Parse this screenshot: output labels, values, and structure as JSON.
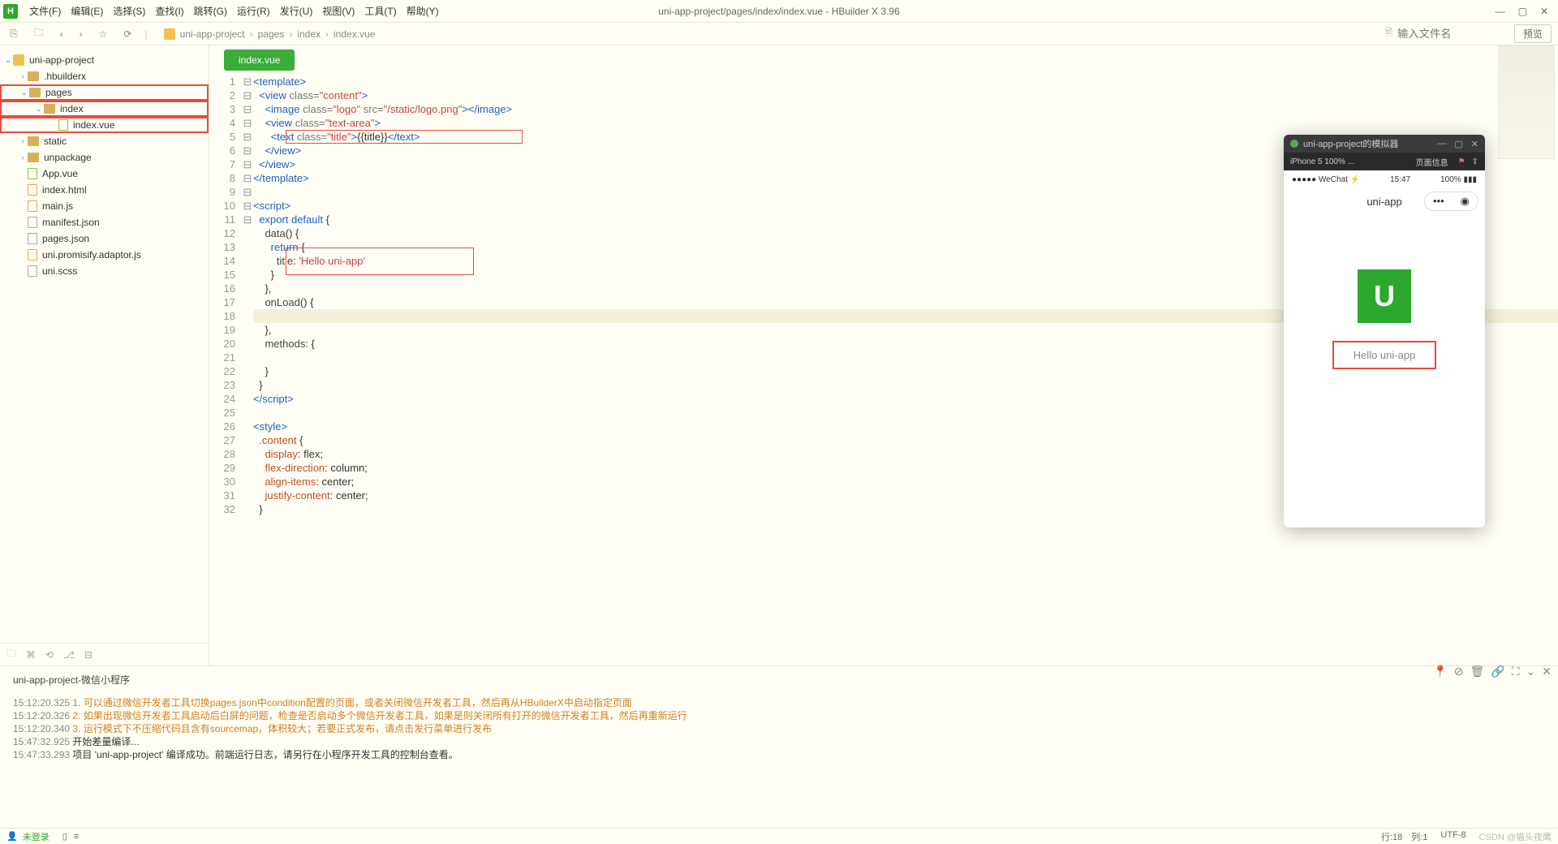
{
  "window_title": "uni-app-project/pages/index/index.vue - HBuilder X 3.96",
  "menus": [
    "文件(F)",
    "编辑(E)",
    "选择(S)",
    "查找(I)",
    "跳转(G)",
    "运行(R)",
    "发行(U)",
    "视图(V)",
    "工具(T)",
    "帮助(Y)"
  ],
  "search_placeholder": "输入文件名",
  "preview_btn": "预览",
  "breadcrumb": [
    "uni-app-project",
    "pages",
    "index",
    "index.vue"
  ],
  "tree": {
    "root": "uni-app-project",
    "items": [
      {
        "label": ".hbuilderx",
        "indent": 1,
        "type": "folder",
        "chev": "›"
      },
      {
        "label": "pages",
        "indent": 1,
        "type": "folder",
        "chev": "⌄",
        "red": true
      },
      {
        "label": "index",
        "indent": 2,
        "type": "folder",
        "chev": "⌄",
        "red": true
      },
      {
        "label": "index.vue",
        "indent": 3,
        "type": "file-green",
        "red": true
      },
      {
        "label": "static",
        "indent": 1,
        "type": "folder",
        "chev": "›"
      },
      {
        "label": "unpackage",
        "indent": 1,
        "type": "folder",
        "chev": "›"
      },
      {
        "label": "App.vue",
        "indent": 1,
        "type": "file-green"
      },
      {
        "label": "index.html",
        "indent": 1,
        "type": "file-orange"
      },
      {
        "label": "main.js",
        "indent": 1,
        "type": "file-orange"
      },
      {
        "label": "manifest.json",
        "indent": 1,
        "type": "file-gray"
      },
      {
        "label": "pages.json",
        "indent": 1,
        "type": "file-gray"
      },
      {
        "label": "uni.promisify.adaptor.js",
        "indent": 1,
        "type": "file-orange"
      },
      {
        "label": "uni.scss",
        "indent": 1,
        "type": "file-gray"
      }
    ]
  },
  "tab_name": "index.vue",
  "code": [
    {
      "n": 1,
      "f": "⊟",
      "h": "<span class='tag'>&lt;template&gt;</span>"
    },
    {
      "n": 2,
      "f": "⊟",
      "h": "  <span class='tag'>&lt;view</span> <span class='attr'>class=</span><span class='str'>\"content\"</span><span class='tag'>&gt;</span>"
    },
    {
      "n": 3,
      "f": "",
      "h": "    <span class='tag'>&lt;image</span> <span class='attr'>class=</span><span class='str'>\"logo\"</span> <span class='attr'>src=</span><span class='str'>\"/static/logo.png\"</span><span class='tag'>&gt;&lt;/image&gt;</span>"
    },
    {
      "n": 4,
      "f": "⊟",
      "h": "    <span class='tag'>&lt;view</span> <span class='attr'>class=</span><span class='str'>\"text-area\"</span><span class='tag'>&gt;</span>"
    },
    {
      "n": 5,
      "f": "",
      "h": "      <span class='tag'>&lt;text</span> <span class='attr'>class=</span><span class='str'>\"title\"</span><span class='tag'>&gt;</span>{{title}}<span class='tag'>&lt;/text&gt;</span>",
      "red": true
    },
    {
      "n": 6,
      "f": "",
      "h": "    <span class='tag'>&lt;/view&gt;</span>"
    },
    {
      "n": 7,
      "f": "",
      "h": "  <span class='tag'>&lt;/view&gt;</span>"
    },
    {
      "n": 8,
      "f": "",
      "h": "<span class='tag'>&lt;/template&gt;</span>"
    },
    {
      "n": 9,
      "f": "",
      "h": ""
    },
    {
      "n": 10,
      "f": "⊟",
      "h": "<span class='tag'>&lt;script&gt;</span>"
    },
    {
      "n": 11,
      "f": "⊟",
      "h": "  <span class='kw'>export default</span> {"
    },
    {
      "n": 12,
      "f": "⊟",
      "h": "    <span class='prop'>data</span>() {"
    },
    {
      "n": 13,
      "f": "⊟",
      "h": "      <span class='kw'>return</span> {"
    },
    {
      "n": 14,
      "f": "",
      "h": "        <span class='prop'>title:</span> <span class='str'>'Hello uni-app'</span>",
      "red2": true
    },
    {
      "n": 15,
      "f": "",
      "h": "      }"
    },
    {
      "n": 16,
      "f": "",
      "h": "    },"
    },
    {
      "n": 17,
      "f": "⊟",
      "h": "    <span class='prop'>onLoad</span>() {"
    },
    {
      "n": 18,
      "f": "",
      "h": "",
      "cur": true
    },
    {
      "n": 19,
      "f": "",
      "h": "    },"
    },
    {
      "n": 20,
      "f": "⊟",
      "h": "    <span class='prop'>methods:</span> {"
    },
    {
      "n": 21,
      "f": "",
      "h": ""
    },
    {
      "n": 22,
      "f": "",
      "h": "    }"
    },
    {
      "n": 23,
      "f": "",
      "h": "  }"
    },
    {
      "n": 24,
      "f": "",
      "h": "<span class='tag'>&lt;/script&gt;</span>"
    },
    {
      "n": 25,
      "f": "",
      "h": ""
    },
    {
      "n": 26,
      "f": "⊟",
      "h": "<span class='tag'>&lt;style&gt;</span>"
    },
    {
      "n": 27,
      "f": "⊟",
      "h": "  <span class='css-prop'>.content</span> {"
    },
    {
      "n": 28,
      "f": "",
      "h": "    <span class='css-prop'>display</span>: flex;"
    },
    {
      "n": 29,
      "f": "",
      "h": "    <span class='css-prop'>flex-direction</span>: column;"
    },
    {
      "n": 30,
      "f": "",
      "h": "    <span class='css-prop'>align-items</span>: center;"
    },
    {
      "n": 31,
      "f": "",
      "h": "    <span class='css-prop'>justify-content</span>: center;"
    },
    {
      "n": 32,
      "f": "",
      "h": "  }"
    }
  ],
  "console": {
    "title": "uni-app-project-微信小程序",
    "lines": [
      {
        "ts": "15:12:20.325",
        "idx": "1.",
        "txt": "可以通过微信开发者工具切换pages.json中condition配置的页面，或者关闭微信开发者工具，然后再从HBuilderX中启动指定页面"
      },
      {
        "ts": "15:12:20.326",
        "idx": "2.",
        "txt": "如果出现微信开发者工具启动后白屏的问题，检查是否启动多个微信开发者工具，如果是则关闭所有打开的微信开发者工具，然后再重新运行"
      },
      {
        "ts": "15:12:20.340",
        "idx": "3.",
        "txt": "运行模式下不压缩代码且含有sourcemap，体积较大；若要正式发布，请点击发行菜单进行发布"
      },
      {
        "ts": "15:47:32.925",
        "idx": "",
        "txt": "开始差量编译..."
      },
      {
        "ts": "15:47:33.293",
        "idx": "",
        "txt": "项目 'uni-app-project' 编译成功。前端运行日志，请另行在小程序开发工具的控制台查看。"
      }
    ]
  },
  "status": {
    "login": "未登录",
    "pos": "行:18　列:1",
    "enc": "UTF-8",
    "watermark": "CSDN @猫头夜鹰"
  },
  "sim": {
    "title": "uni-app-project的模拟器",
    "device": "iPhone 5 100% ...",
    "info": "页面信息",
    "carrier": "●●●●● WeChat ⚡",
    "time": "15:47",
    "battery": "100% ▮▮▮",
    "nav": "uni-app",
    "hello": "Hello uni-app",
    "logo": "U"
  }
}
